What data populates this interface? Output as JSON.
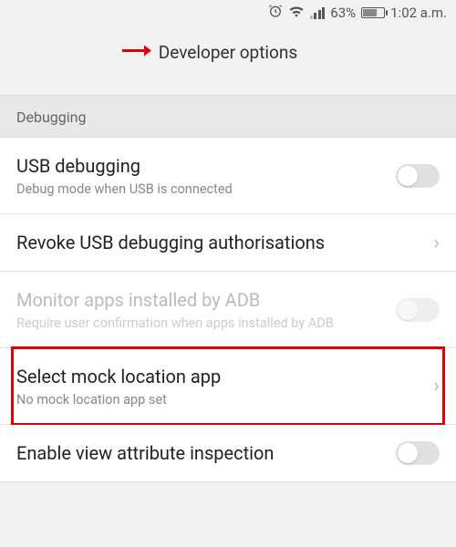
{
  "status": {
    "battery_pct": "63%",
    "time": "1:02 a.m."
  },
  "header": {
    "title": "Developer options"
  },
  "section": {
    "debugging": "Debugging"
  },
  "rows": {
    "usb_debug": {
      "title": "USB debugging",
      "subtitle": "Debug mode when USB is connected"
    },
    "revoke": {
      "title": "Revoke USB debugging authorisations"
    },
    "monitor_adb": {
      "title": "Monitor apps installed by ADB",
      "subtitle": "Require user confirmation when apps installed by ADB"
    },
    "mock_location": {
      "title": "Select mock location app",
      "subtitle": "No mock location app set"
    },
    "view_attr": {
      "title": "Enable view attribute inspection"
    }
  }
}
